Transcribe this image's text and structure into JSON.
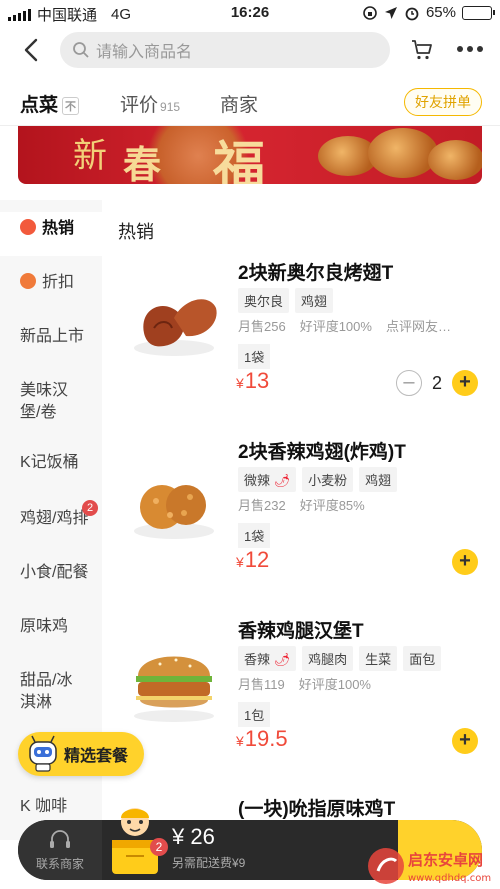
{
  "status_bar": {
    "carrier": "中国联通",
    "network": "4G",
    "time": "16:26",
    "battery": "65%",
    "battery_level": 0.65
  },
  "search": {
    "placeholder": "请输入商品名"
  },
  "tabs": [
    {
      "label": "点菜",
      "pin": "不"
    },
    {
      "label": "评价",
      "count": "915"
    },
    {
      "label": "商家"
    }
  ],
  "friend_order_label": "好友拼单",
  "banner": {
    "text1": "新",
    "text2": "春",
    "text3": "福"
  },
  "sidebar": {
    "items": [
      {
        "label": "热销",
        "icon": "flame-icon",
        "active": true
      },
      {
        "label": "折扣",
        "icon": "discount-icon"
      },
      {
        "label": "新品上市"
      },
      {
        "label": "美味汉堡/卷"
      },
      {
        "label": "K记饭桶"
      },
      {
        "label": "鸡翅/鸡排",
        "badge": "2"
      },
      {
        "label": "小食/配餐"
      },
      {
        "label": "原味鸡"
      },
      {
        "label": "甜品/冰淇淋"
      },
      {
        "label": "K 咖啡"
      }
    ],
    "combo_button": "精选套餐"
  },
  "section_title": "热销",
  "products": [
    {
      "name": "2块新奥尔良烤翅T",
      "tags": [
        "奥尔良",
        "鸡翅"
      ],
      "monthly_sales": "月售256",
      "rating": "好评度100%",
      "review": "点评网友…",
      "unit": "1袋",
      "currency": "¥",
      "price": "13",
      "quantity": "2"
    },
    {
      "name": "2块香辣鸡翅(炸鸡)T",
      "tags": [
        "微辣",
        "小麦粉",
        "鸡翅"
      ],
      "monthly_sales": "月售232",
      "rating": "好评度85%",
      "unit": "1袋",
      "currency": "¥",
      "price": "12"
    },
    {
      "name": "香辣鸡腿汉堡T",
      "tags": [
        "香辣",
        "鸡腿肉",
        "生菜",
        "面包"
      ],
      "monthly_sales": "月售119",
      "rating": "好评度100%",
      "unit": "1包",
      "currency": "¥",
      "price": "19.5"
    },
    {
      "name": "(一块)吮指原味鸡T"
    }
  ],
  "bottom_bar": {
    "contact_label": "联系商家",
    "cart_count": "2",
    "currency": "¥",
    "total": "26",
    "delivery_fee": "另需配送费¥9"
  },
  "watermark": {
    "text1": "启东安卓网",
    "text2": "www.qdhdq.com"
  },
  "colors": {
    "accent": "#ffd22b",
    "price": "#f04a3a",
    "banner": "#c21c26"
  }
}
